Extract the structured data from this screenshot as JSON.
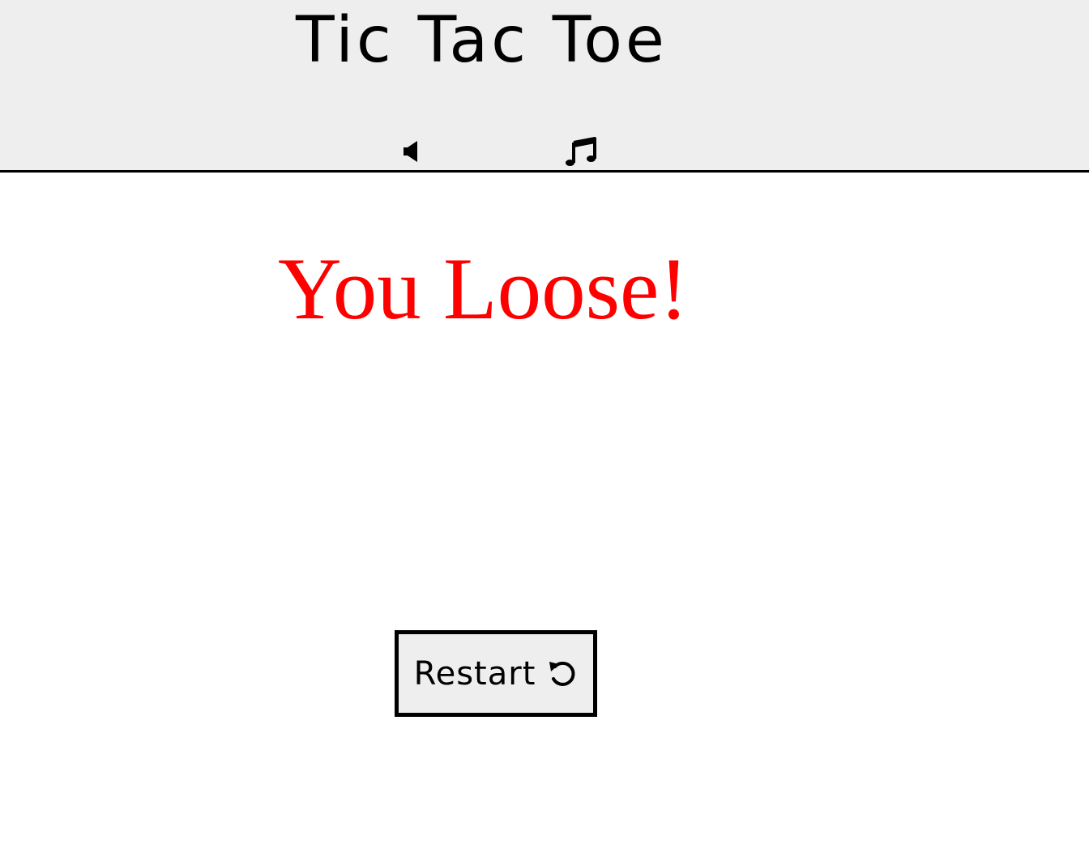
{
  "header": {
    "title": "Tic Tac Toe",
    "sound_icon": "volume-icon",
    "music_icon": "music-note-icon"
  },
  "result": {
    "message": "You Loose!",
    "color": "#ff0000"
  },
  "controls": {
    "restart_label": "Restart",
    "restart_icon": "undo-icon"
  }
}
